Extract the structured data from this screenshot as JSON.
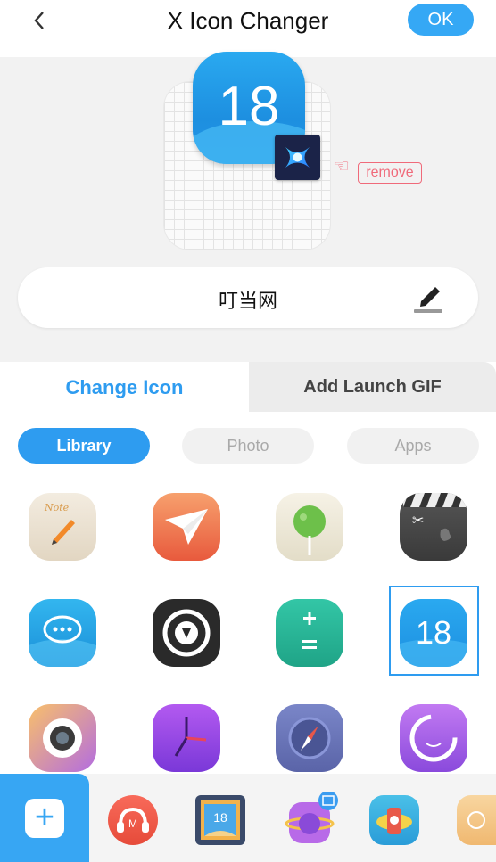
{
  "header": {
    "back_icon": "chevron-left-icon",
    "title": "X Icon Changer",
    "ok_label": "OK"
  },
  "preview": {
    "icon_number": "18",
    "remove_label": "remove",
    "app_name": "叮当网",
    "edit_icon": "pencil-icon"
  },
  "tabs": {
    "change_icon": "Change Icon",
    "add_gif": "Add Launch GIF"
  },
  "subtabs": {
    "library": "Library",
    "photo": "Photo",
    "apps": "Apps"
  },
  "grid": {
    "row1": [
      "notes-icon",
      "paper-plane-icon",
      "lollipop-icon",
      "clapperboard-icon"
    ],
    "row2": [
      "message-bubble-icon",
      "camera-shutter-icon",
      "calculator-icon",
      "calendar-18-icon"
    ],
    "row3": [
      "camera-lens-icon",
      "clock-icon",
      "compass-icon",
      "smiley-icon"
    ],
    "calendar_number": "18",
    "note_text": "Note"
  },
  "tray": {
    "add_icon": "plus-icon",
    "items": [
      "music-headphones-icon",
      "photo-frame-icon",
      "planet-video-icon",
      "toy-plane-icon",
      "card-app-icon"
    ],
    "frame_number": "18"
  },
  "colors": {
    "accent": "#2e9cf0",
    "remove": "#f06a7a"
  }
}
